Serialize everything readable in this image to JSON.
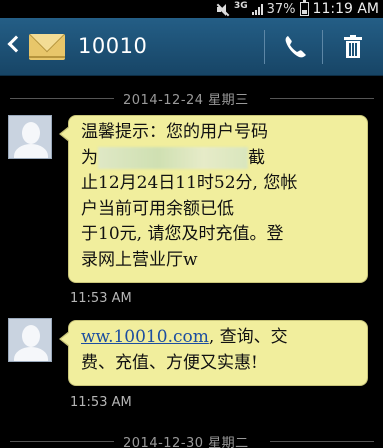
{
  "status_bar": {
    "network": "3G",
    "battery": "37%",
    "time": "11:19 AM"
  },
  "header": {
    "title": "10010",
    "icons": [
      "back-icon",
      "message-envelope-icon",
      "phone-icon",
      "trash-icon"
    ]
  },
  "conversation": {
    "dates": [
      "2014-12-24 星期三",
      "2014-12-30 星期二"
    ],
    "messages": [
      {
        "line1": "温馨提示：您的用户号码",
        "line2_pre": "为",
        "line2_post": "截",
        "rest": "止12月24日11时52分, 您帐\n户当前可用余额已低\n于10元, 请您及时充值。登\n录网上营业厅w",
        "time": "11:53 AM"
      },
      {
        "link": "ww.10010.com",
        "text_after_link": ", 查询、交",
        "rest": "费、充值、方便又实惠!",
        "time": "11:53 AM"
      }
    ]
  },
  "colors": {
    "action_bar": "#1c5276",
    "bubble": "#f1ee9d",
    "link": "#1c4ea0"
  }
}
